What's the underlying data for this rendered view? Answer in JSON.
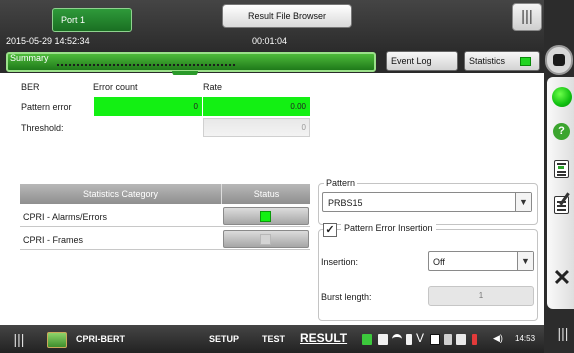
{
  "header": {
    "port_tab": "Port 1",
    "result_browser": "Result File Browser",
    "datetime": "2015-05-29 14:52:34",
    "elapsed": "00:01:04"
  },
  "summary": {
    "label": "Summary",
    "event_log": "Event Log",
    "statistics": "Statistics",
    "statistics_led_color": "#23d423"
  },
  "ber": {
    "title": "BER",
    "col_error_count": "Error count",
    "col_rate": "Rate",
    "row_pattern_error": "Pattern error",
    "pattern_error_count": "0",
    "pattern_error_rate": "0.00",
    "row_threshold": "Threshold:",
    "threshold_value": "0"
  },
  "stats_table": {
    "header_category": "Statistics Category",
    "header_status": "Status",
    "rows": [
      {
        "category": "CPRI - Alarms/Errors",
        "status_color": "#13f013"
      },
      {
        "category": "CPRI - Frames",
        "status_color": "#cfcfcf"
      }
    ]
  },
  "pattern": {
    "legend": "Pattern",
    "value": "PRBS15"
  },
  "error_insertion": {
    "legend": "Pattern Error Insertion",
    "checked": true,
    "insertion_label": "Insertion:",
    "insertion_value": "Off",
    "burst_label": "Burst length:",
    "burst_value": "1"
  },
  "footer": {
    "app_name": "CPRI-BERT",
    "nav_setup": "SETUP",
    "nav_test": "TEST",
    "nav_result": "RESULT",
    "time": "14:53"
  },
  "sidebar_icons": [
    "stop-icon",
    "global-status-led",
    "help-icon",
    "report-icon",
    "notes-icon",
    "close-icon"
  ],
  "colors": {
    "accent_green": "#13f013",
    "bar_dark": "#2b2b2b"
  }
}
